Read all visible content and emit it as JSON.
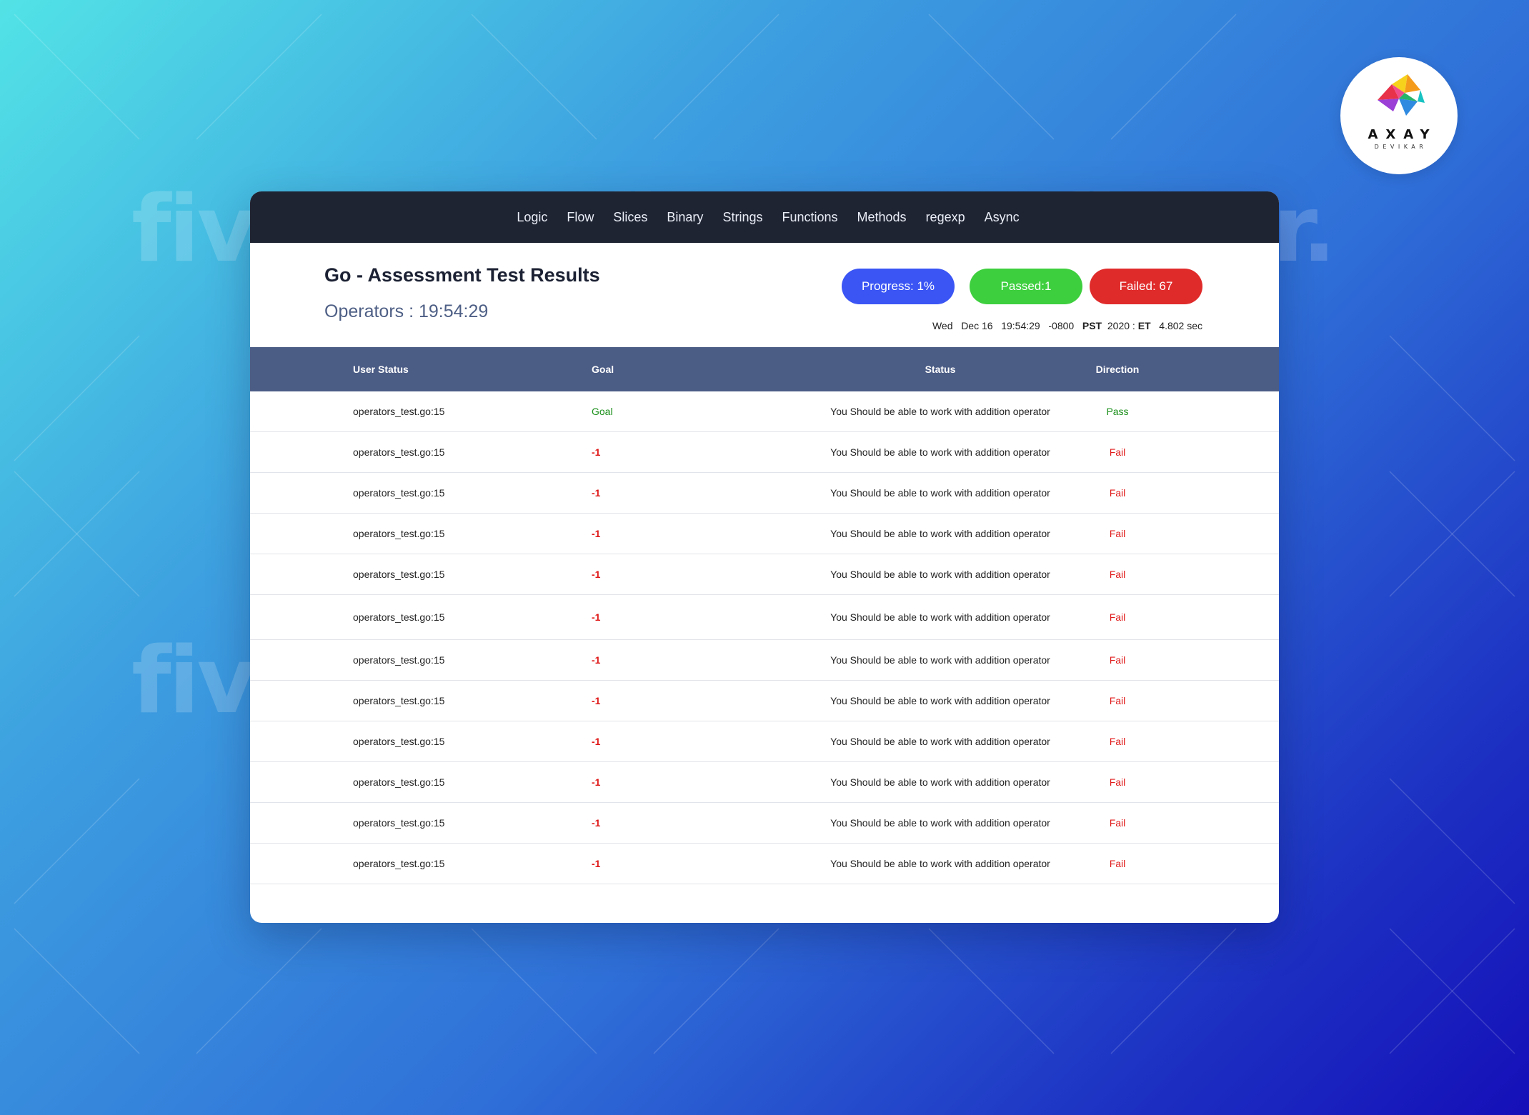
{
  "watermark": {
    "text": "fiverr",
    "dot": "."
  },
  "logo": {
    "brand": "AXAY",
    "brand_sub": "DEVIKAR"
  },
  "nav": {
    "items": [
      "Logic",
      "Flow",
      "Slices",
      "Binary",
      "Strings",
      "Functions",
      "Methods",
      "regexp",
      "Async"
    ]
  },
  "header": {
    "title": "Go - Assessment Test Results",
    "subtitle": "Operators : 19:54:29",
    "progress": "Progress: 1%",
    "passed": "Passed:1",
    "failed": "Failed: 67",
    "timestamp": {
      "day": "Wed",
      "date": "Dec 16",
      "time": "19:54:29",
      "offset": "-0800",
      "zone": "PST",
      "year": "2020 :",
      "zone2": "ET",
      "duration": "4.802 sec"
    }
  },
  "table": {
    "columns": [
      "User Status",
      "Goal",
      "Status",
      "Direction"
    ],
    "rows": [
      {
        "user_status": "operators_test.go:15",
        "goal": "Goal",
        "status": "You Should be able to work with addition operator",
        "direction": "Pass"
      },
      {
        "user_status": "operators_test.go:15",
        "goal": "-1",
        "status": "You Should be able to work with addition operator",
        "direction": "Fail"
      },
      {
        "user_status": "operators_test.go:15",
        "goal": "-1",
        "status": "You Should be able to work with addition operator",
        "direction": "Fail"
      },
      {
        "user_status": "operators_test.go:15",
        "goal": "-1",
        "status": "You Should be able to work with addition operator",
        "direction": "Fail"
      },
      {
        "user_status": "operators_test.go:15",
        "goal": "-1",
        "status": "You Should be able to work with addition operator",
        "direction": "Fail"
      },
      {
        "user_status": "operators_test.go:15",
        "goal": "-1",
        "status": "You Should be able to work with addition operator",
        "direction": "Fail"
      },
      {
        "user_status": "operators_test.go:15",
        "goal": "-1",
        "status": "You Should be able to work with addition operator",
        "direction": "Fail"
      },
      {
        "user_status": "operators_test.go:15",
        "goal": "-1",
        "status": "You Should be able to work with addition operator",
        "direction": "Fail"
      },
      {
        "user_status": "operators_test.go:15",
        "goal": "-1",
        "status": "You Should be able to work with addition operator",
        "direction": "Fail"
      },
      {
        "user_status": "operators_test.go:15",
        "goal": "-1",
        "status": "You Should be able to work with addition operator",
        "direction": "Fail"
      },
      {
        "user_status": "operators_test.go:15",
        "goal": "-1",
        "status": "You Should be able to work with addition operator",
        "direction": "Fail"
      },
      {
        "user_status": "operators_test.go:15",
        "goal": "-1",
        "status": "You Should be able to work with addition operator",
        "direction": "Fail"
      }
    ]
  },
  "colors": {
    "navbar": "#1f2433",
    "table_header": "#4b5c85",
    "progress": "#3a55f4",
    "passed": "#3ecf3e",
    "failed": "#e02b2b",
    "pass_text": "#1a8f1a",
    "fail_text": "#e01919"
  }
}
